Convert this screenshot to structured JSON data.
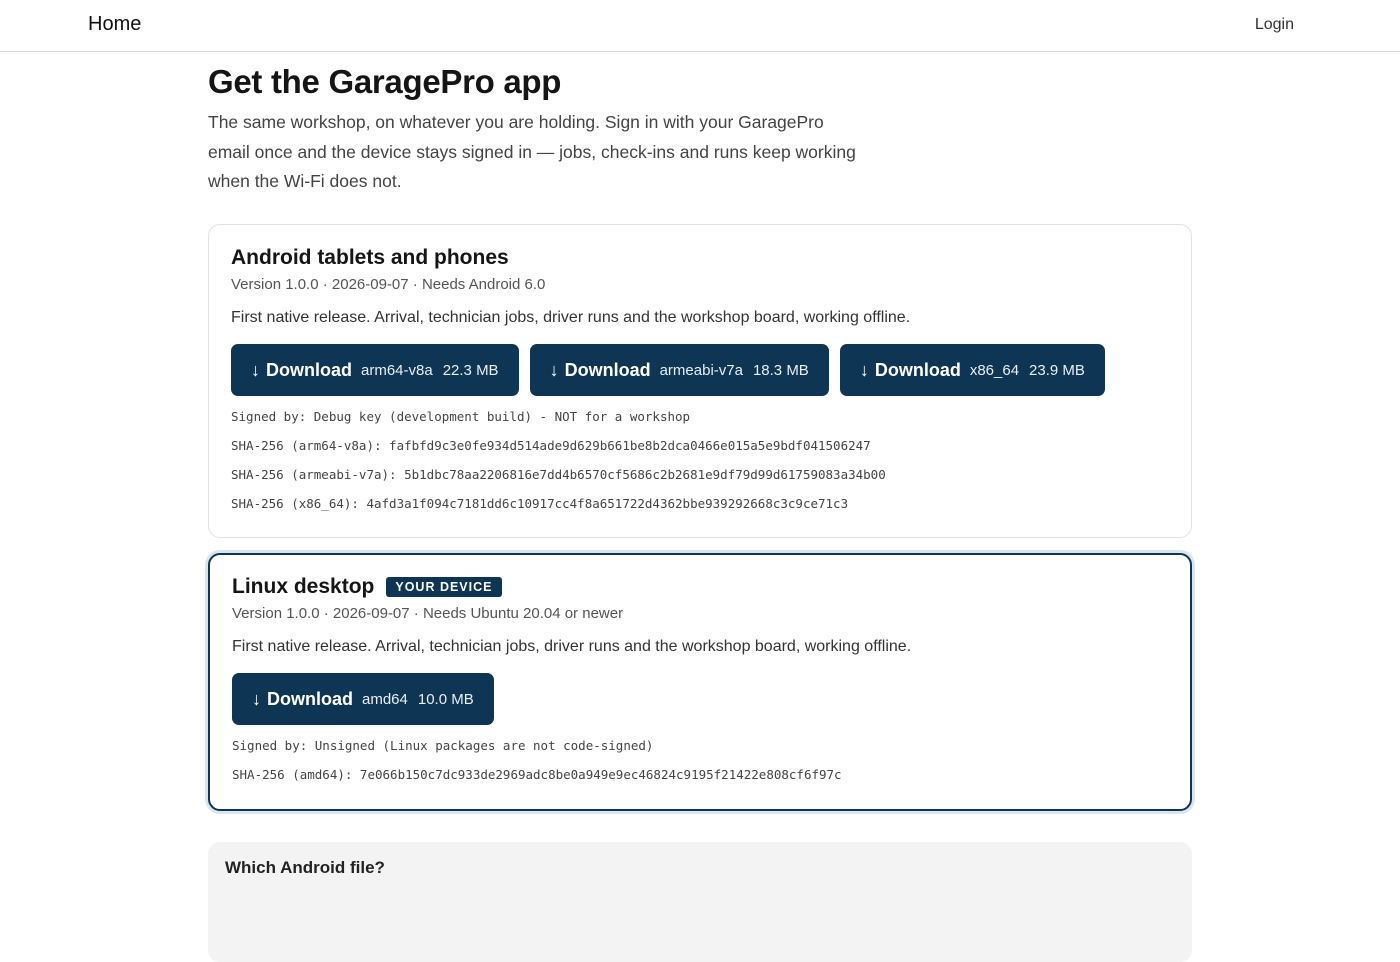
{
  "nav": {
    "home": "Home",
    "login": "Login"
  },
  "page": {
    "title": "Get the GaragePro app",
    "intro": "The same workshop, on whatever you are holding. Sign in with your GaragePro email once and the device stays signed in — jobs, check-ins and runs keep working when the Wi-Fi does not."
  },
  "android": {
    "title": "Android tablets and phones",
    "meta": "Version 1.0.0 · 2026-09-07 · Needs Android 6.0",
    "description": "First native release. Arrival, technician jobs, driver runs and the workshop board, working offline.",
    "buttons": [
      {
        "label": "Download",
        "arch": "arm64-v8a",
        "size": "22.3 MB"
      },
      {
        "label": "Download",
        "arch": "armeabi-v7a",
        "size": "18.3 MB"
      },
      {
        "label": "Download",
        "arch": "x86_64",
        "size": "23.9 MB"
      }
    ],
    "signed_by": "Signed by: Debug key (development build) - NOT for a workshop",
    "hashes": [
      "SHA-256 (arm64-v8a): fafbfd9c3e0fe934d514ade9d629b661be8b2dca0466e015a5e9bdf041506247",
      "SHA-256 (armeabi-v7a): 5b1dbc78aa2206816e7dd4b6570cf5686c2b2681e9df79d99d61759083a34b00",
      "SHA-256 (x86_64): 4afd3a1f094c7181dd6c10917cc4f8a651722d4362bbe939292668c3c9ce71c3"
    ]
  },
  "linux": {
    "title": "Linux desktop",
    "badge": "YOUR DEVICE",
    "meta": "Version 1.0.0 · 2026-09-07 · Needs Ubuntu 20.04 or newer",
    "description": "First native release. Arrival, technician jobs, driver runs and the workshop board, working offline.",
    "buttons": [
      {
        "label": "Download",
        "arch": "amd64",
        "size": "10.0 MB"
      }
    ],
    "signed_by": "Signed by: Unsigned (Linux packages are not code-signed)",
    "hashes": [
      "SHA-256 (amd64): 7e066b150c7dc933de2969adc8be0a949e9ec46824c9195f21422e808cf6f97c"
    ]
  },
  "faq": {
    "title": "Which Android file?"
  },
  "icons": {
    "download": "arrow-down-icon"
  }
}
